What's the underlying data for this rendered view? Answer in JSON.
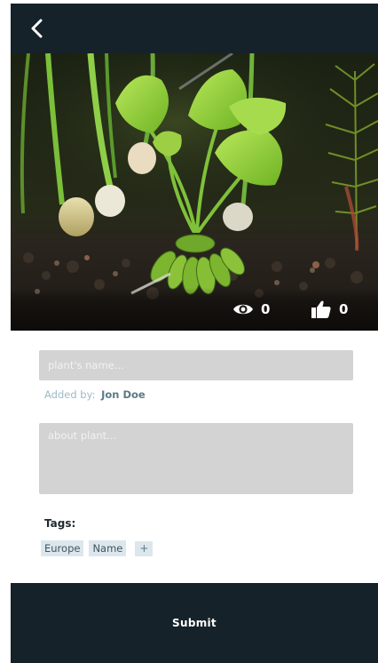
{
  "header": {
    "back_icon": "chevron-left-icon"
  },
  "photo": {
    "subject": "aquarium-plant-bulb",
    "views_icon": "eye-icon",
    "views_count": "0",
    "likes_icon": "thumbs-up-icon",
    "likes_count": "0"
  },
  "form": {
    "name_placeholder": "plant's name...",
    "added_by_label": "Added by:",
    "added_by_name": "Jon Doe",
    "about_placeholder": "about plant...",
    "tags_title": "Tags:",
    "tags": [
      "Europe",
      "Name"
    ],
    "add_tag_label": "+",
    "submit_label": "Submit"
  },
  "colors": {
    "bar_background": "#152229",
    "input_background": "#d3d3d3",
    "tag_background": "#dbe7ec",
    "accent_text": "#9dbac7"
  }
}
